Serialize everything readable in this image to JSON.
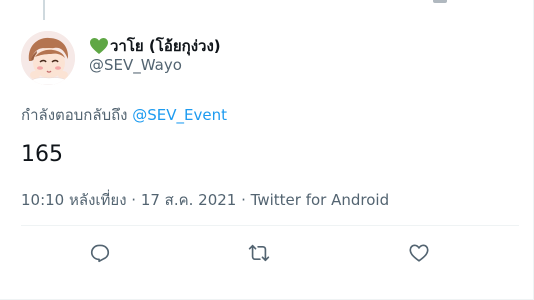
{
  "tweet": {
    "display_name": "วาโย (โอ้ยกุง่วง)",
    "handle": "@SEV_Wayo",
    "name_emoji": "green-heart-icon",
    "reply_prefix": "กำลังตอบกลับถึง ",
    "reply_to": "@SEV_Event",
    "text": "165",
    "timestamp": "10:10 หลังเที่ยง · 17 ส.ค. 2021 · Twitter for Android"
  },
  "actions": [
    {
      "name": "reply-icon"
    },
    {
      "name": "retweet-icon"
    },
    {
      "name": "like-icon"
    }
  ],
  "colors": {
    "accent": "#1d9bf0",
    "secondary_text": "#536471",
    "primary_text": "#0f1419",
    "heart": "#5fa745"
  }
}
